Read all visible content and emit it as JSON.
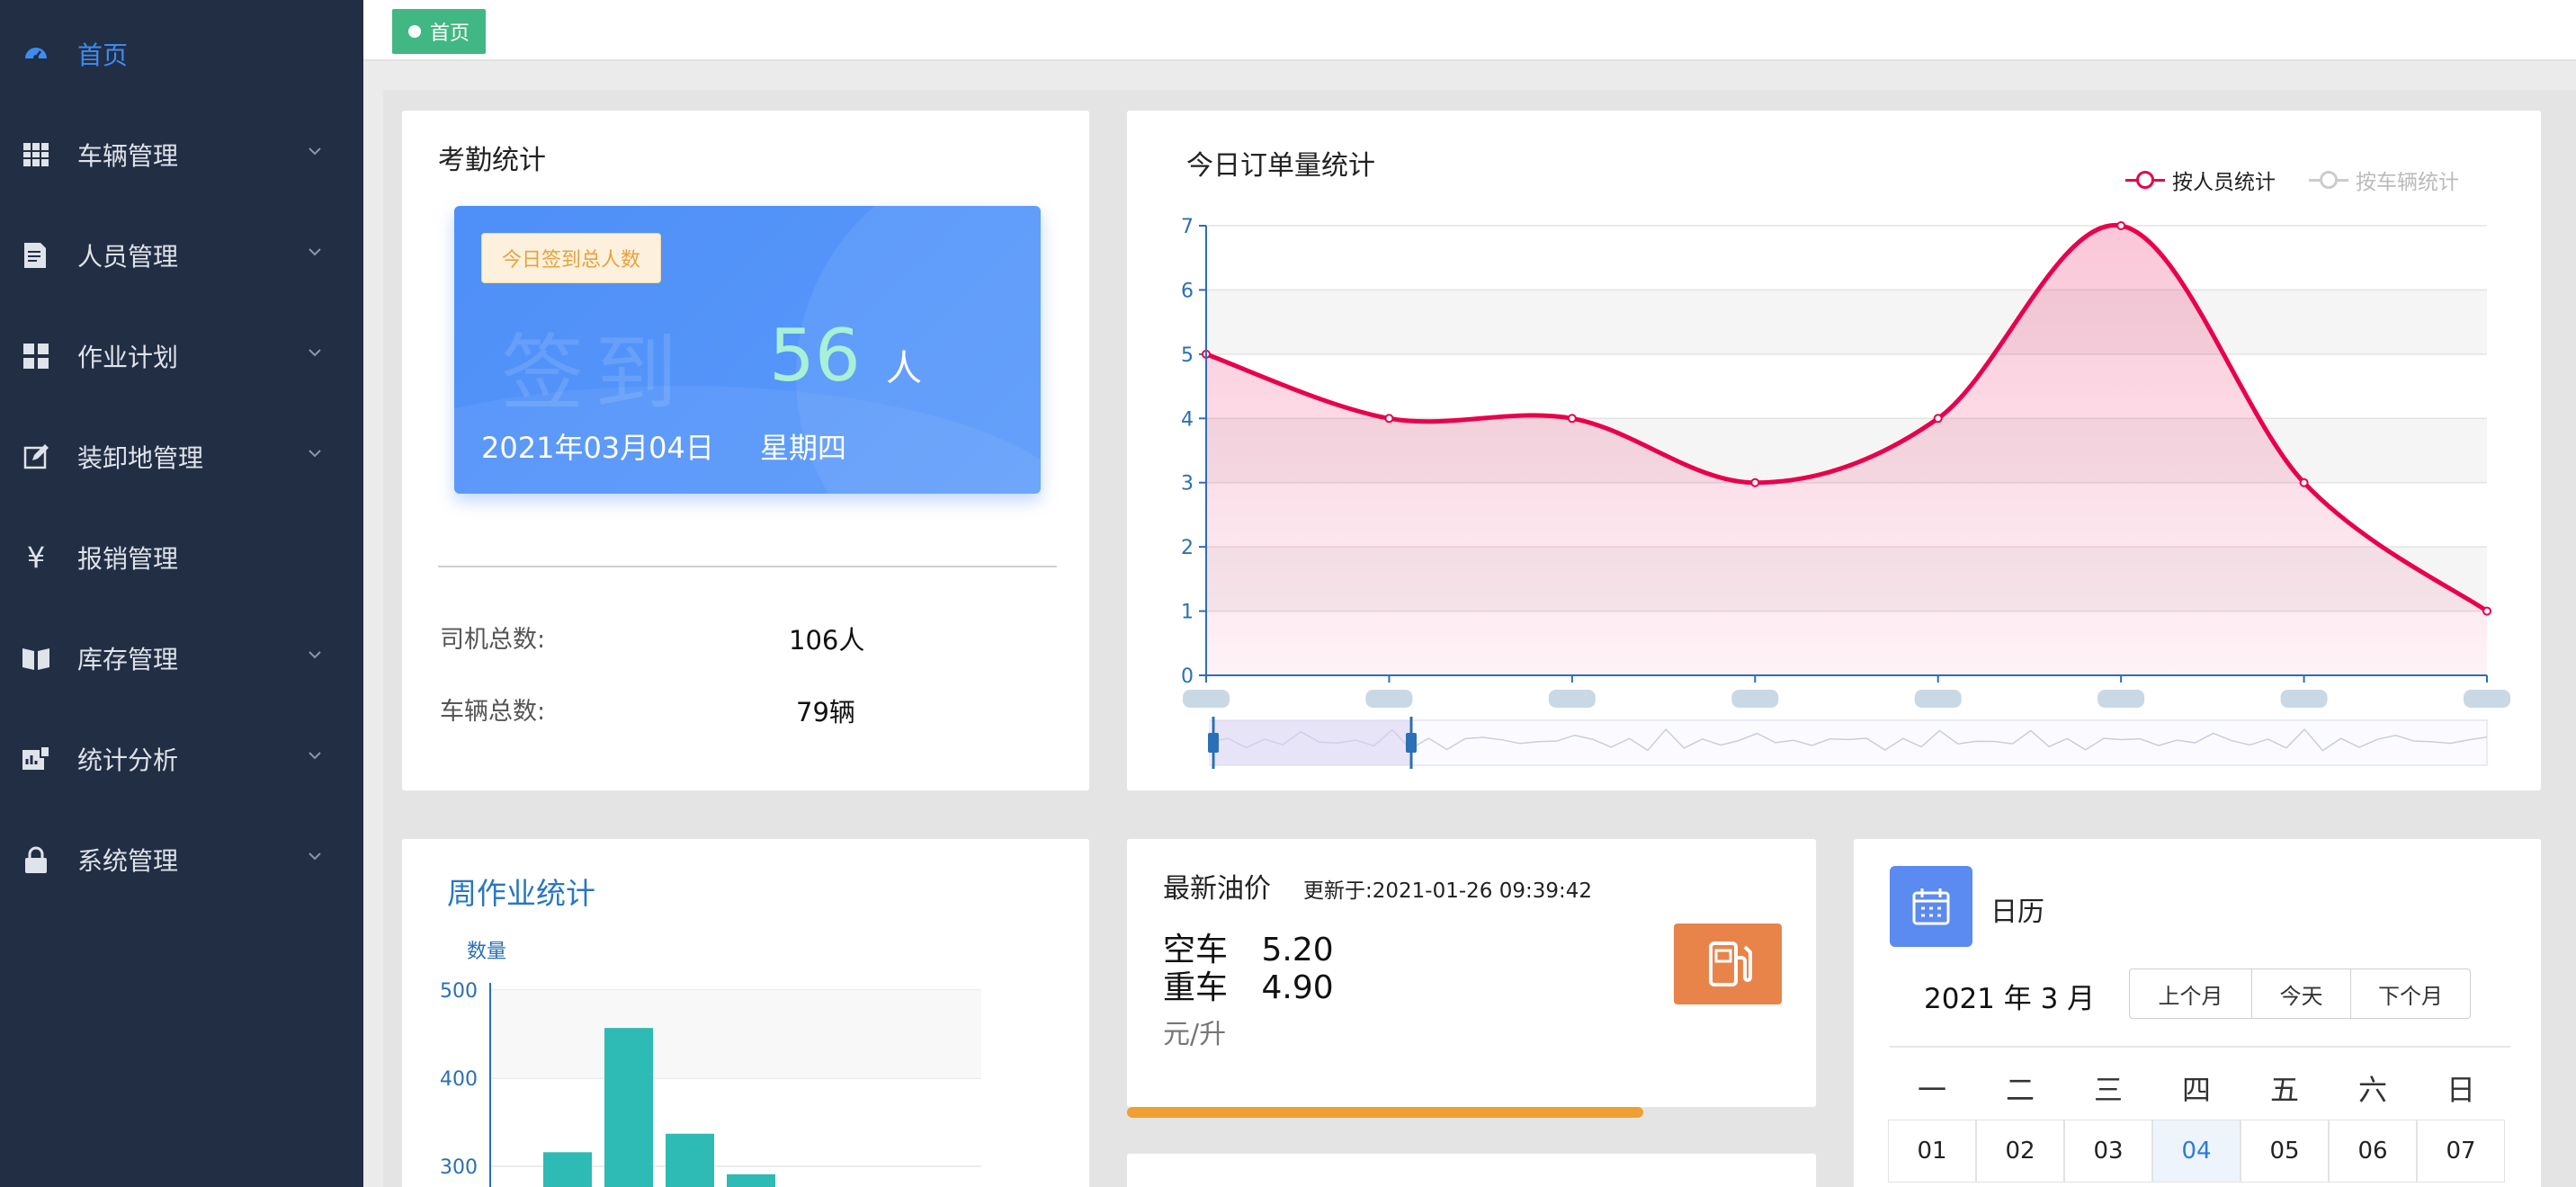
{
  "sidebar": {
    "items": [
      {
        "label": "首页",
        "icon": "dashboard-icon",
        "active": true
      },
      {
        "label": "车辆管理",
        "icon": "grid-table-icon"
      },
      {
        "label": "人员管理",
        "icon": "document-list-icon"
      },
      {
        "label": "作业计划",
        "icon": "apps-grid-icon"
      },
      {
        "label": "装卸地管理",
        "icon": "edit-icon"
      },
      {
        "label": "报销管理",
        "icon": "yen-icon"
      },
      {
        "label": "库存管理",
        "icon": "book-icon"
      },
      {
        "label": "统计分析",
        "icon": "chart-report-icon"
      },
      {
        "label": "系统管理",
        "icon": "lock-icon"
      }
    ]
  },
  "tabs": {
    "home_label": "首页"
  },
  "attendance": {
    "title": "考勤统计",
    "badge": "今日签到总人数",
    "watermark": "签到",
    "count": "56",
    "unit": "人",
    "date": "2021年03月04日",
    "weekday": "星期四",
    "driver_label": "司机总数:",
    "driver_value": "106人",
    "vehicle_label": "车辆总数:",
    "vehicle_value": "79辆"
  },
  "orders": {
    "title": "今日订单量统计",
    "legend": [
      {
        "label": "按人员统计",
        "color": "#e8004c",
        "active": true
      },
      {
        "label": "按车辆统计",
        "color": "#cccccc",
        "active": false
      }
    ]
  },
  "chart_data": [
    {
      "type": "area",
      "title": "今日订单量统计",
      "series": [
        {
          "name": "按人员统计",
          "values": [
            5,
            4,
            4,
            3,
            4,
            7,
            3,
            1
          ]
        }
      ],
      "categories": [
        "",
        "",
        "",
        "",
        "",
        "",
        "",
        ""
      ],
      "ylim": [
        0,
        7
      ],
      "yticks": [
        0,
        1,
        2,
        3,
        4,
        5,
        6,
        7
      ],
      "grid": true,
      "legend": "top-right",
      "color": "#e8004c"
    },
    {
      "type": "bar",
      "title": "周作业统计",
      "ylabel": "数量",
      "yticks": [
        300,
        400,
        500
      ],
      "values": [
        316,
        457,
        337,
        291
      ],
      "color": "#2ebbb5"
    }
  ],
  "weekly": {
    "title": "周作业统计",
    "ylabel": "数量"
  },
  "oil": {
    "title": "最新油价",
    "updated": "更新于:2021-01-26 09:39:42",
    "empty_label": "空车",
    "empty_price": "5.20",
    "loaded_label": "重车",
    "loaded_price": "4.90",
    "unit": "元/升",
    "progress": 0.74
  },
  "calendar": {
    "title": "日历",
    "month": "2021 年 3 月",
    "prev": "上个月",
    "today": "今天",
    "next": "下个月",
    "weekdays": [
      "一",
      "二",
      "三",
      "四",
      "五",
      "六",
      "日"
    ],
    "days": [
      "01",
      "02",
      "03",
      "04",
      "05",
      "06",
      "07"
    ],
    "today_index": 3
  }
}
